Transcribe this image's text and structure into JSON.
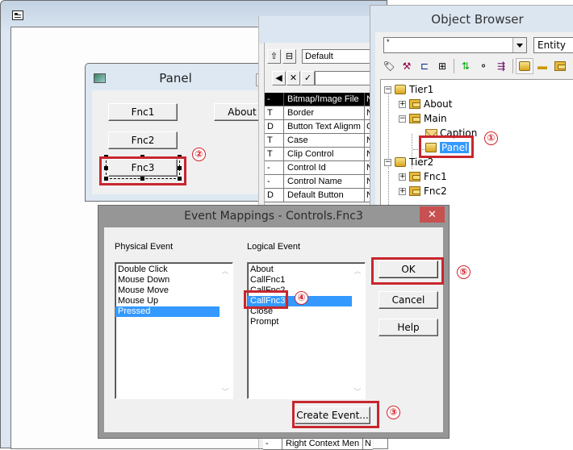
{
  "main_window": {
    "icon": "form-window-icon"
  },
  "panel_window": {
    "title": "Panel",
    "buttons": [
      {
        "label": "Fnc1"
      },
      {
        "label": "Fnc2"
      },
      {
        "label": "Fnc3"
      },
      {
        "label": "About"
      }
    ]
  },
  "property_grid": {
    "combo_value": "Default",
    "edit_value": "",
    "toolbar": [
      "up-level-icon",
      "tree-view-icon",
      "back-arrow-icon",
      "cancel-x-icon",
      "accept-check-icon"
    ],
    "toolbar_glyphs": [
      "⇧",
      "⊟",
      "◀",
      "✕",
      "✓"
    ],
    "rows": [
      {
        "flag": "-",
        "name": "Bitmap/Image File",
        "value": "N",
        "selected": true
      },
      {
        "flag": "T",
        "name": "Border",
        "value": "N"
      },
      {
        "flag": "D",
        "name": "Button Text Alignm",
        "value": "C"
      },
      {
        "flag": "T",
        "name": "Case",
        "value": "N"
      },
      {
        "flag": "T",
        "name": "Clip Control",
        "value": "N"
      },
      {
        "flag": "-",
        "name": "Control Id",
        "value": "N"
      },
      {
        "flag": "-",
        "name": "Control Name",
        "value": "N"
      },
      {
        "flag": "D",
        "name": "Default Button",
        "value": "N"
      }
    ],
    "bottom_row": {
      "flag": "-",
      "name": "Right Context Men",
      "value": "N"
    }
  },
  "object_browser": {
    "title": "Object Browser",
    "filter_value": "*",
    "type_value": "Entity",
    "tree": [
      {
        "label": "Tier1",
        "icon": "entity-cube-icon",
        "expander": "−"
      },
      {
        "label": "About",
        "icon": "form-icon",
        "expander": "+"
      },
      {
        "label": "Main",
        "icon": "form-icon",
        "expander": "−"
      },
      {
        "label": "Caption",
        "icon": "envelope-icon",
        "expander": ""
      },
      {
        "label": "Panel",
        "icon": "panel-icon",
        "expander": "",
        "selected": true
      },
      {
        "label": "Tier2",
        "icon": "entity-cube-icon",
        "expander": "−"
      },
      {
        "label": "Fnc1",
        "icon": "form-icon",
        "expander": "+"
      },
      {
        "label": "Fnc2",
        "icon": "form-icon",
        "expander": "+"
      }
    ]
  },
  "event_dialog": {
    "title": "Event Mappings - Controls.Fnc3",
    "close_glyph": "✕",
    "physical_label": "Physical Event",
    "logical_label": "Logical Event",
    "physical_events": [
      "Double Click",
      "Mouse Down",
      "Mouse Move",
      "Mouse Up",
      "Pressed"
    ],
    "physical_selected": "Pressed",
    "logical_events": [
      "About",
      "CallFnc1",
      "CallFnc2",
      "CallFnc3",
      "Close",
      "Prompt"
    ],
    "logical_selected": "CallFnc3",
    "ok_label": "OK",
    "cancel_label": "Cancel",
    "help_label": "Help",
    "create_label": "Create Event..."
  },
  "annotations": {
    "n1": "①",
    "n2": "②",
    "n3": "③",
    "n4": "④",
    "n5": "⑤",
    "color": "#c8262e"
  }
}
